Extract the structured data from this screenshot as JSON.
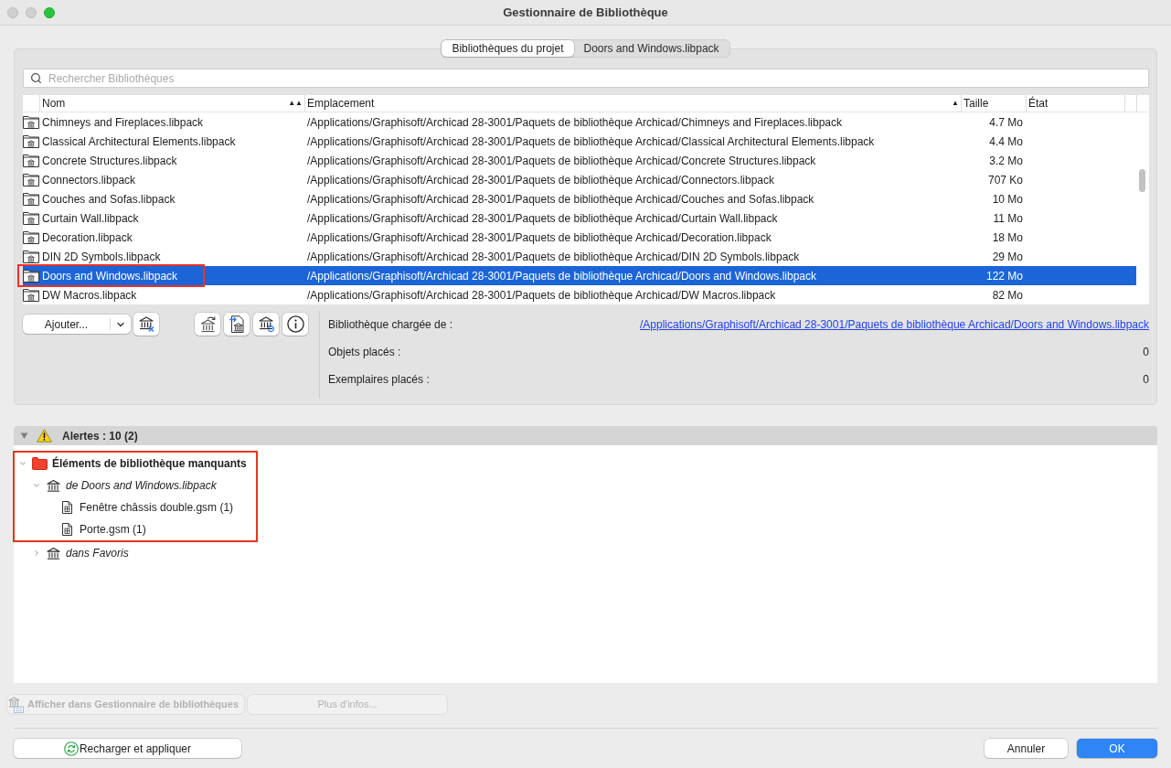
{
  "window": {
    "title": "Gestionnaire de Bibliothèque",
    "controls": [
      {
        "kind": "close",
        "disabled": true
      },
      {
        "kind": "minimize",
        "disabled": true
      },
      {
        "kind": "zoom",
        "disabled": false
      }
    ]
  },
  "tabs": [
    {
      "label": "Bibliothèques du projet",
      "selected": true
    },
    {
      "label": "Doors and Windows.libpack",
      "selected": false
    }
  ],
  "search": {
    "placeholder": "Rechercher Bibliothèques"
  },
  "table": {
    "columns": [
      {
        "label": "Nom",
        "sort_mark": "▲▲"
      },
      {
        "label": "Emplacement",
        "sort_mark": "▲"
      },
      {
        "label": "Taille"
      },
      {
        "label": "État"
      }
    ],
    "rows": [
      {
        "name": "Chimneys and Fireplaces.libpack",
        "location": "/Applications/Graphisoft/Archicad 28-3001/Paquets de bibliothèque Archicad/Chimneys and Fireplaces.libpack",
        "size": "4.7 Mo",
        "selected": false,
        "outlined": false
      },
      {
        "name": "Classical Architectural Elements.libpack",
        "location": "/Applications/Graphisoft/Archicad 28-3001/Paquets de bibliothèque Archicad/Classical Architectural Elements.libpack",
        "size": "4.4 Mo",
        "selected": false,
        "outlined": false
      },
      {
        "name": "Concrete Structures.libpack",
        "location": "/Applications/Graphisoft/Archicad 28-3001/Paquets de bibliothèque Archicad/Concrete Structures.libpack",
        "size": "3.2 Mo",
        "selected": false,
        "outlined": false
      },
      {
        "name": "Connectors.libpack",
        "location": "/Applications/Graphisoft/Archicad 28-3001/Paquets de bibliothèque Archicad/Connectors.libpack",
        "size": "707 Ko",
        "selected": false,
        "outlined": false
      },
      {
        "name": "Couches and Sofas.libpack",
        "location": "/Applications/Graphisoft/Archicad 28-3001/Paquets de bibliothèque Archicad/Couches and Sofas.libpack",
        "size": "10 Mo",
        "selected": false,
        "outlined": false
      },
      {
        "name": "Curtain Wall.libpack",
        "location": "/Applications/Graphisoft/Archicad 28-3001/Paquets de bibliothèque Archicad/Curtain Wall.libpack",
        "size": "11 Mo",
        "selected": false,
        "outlined": false
      },
      {
        "name": "Decoration.libpack",
        "location": "/Applications/Graphisoft/Archicad 28-3001/Paquets de bibliothèque Archicad/Decoration.libpack",
        "size": "18 Mo",
        "selected": false,
        "outlined": false
      },
      {
        "name": "DIN 2D Symbols.libpack",
        "location": "/Applications/Graphisoft/Archicad 28-3001/Paquets de bibliothèque Archicad/DIN 2D Symbols.libpack",
        "size": "29 Mo",
        "selected": false,
        "outlined": false
      },
      {
        "name": "Doors and Windows.libpack",
        "location": "/Applications/Graphisoft/Archicad 28-3001/Paquets de bibliothèque Archicad/Doors and Windows.libpack",
        "size": "122 Mo",
        "selected": true,
        "outlined": true
      },
      {
        "name": "DW Macros.libpack",
        "location": "/Applications/Graphisoft/Archicad 28-3001/Paquets de bibliothèque Archicad/DW Macros.libpack",
        "size": "82 Mo",
        "selected": false,
        "outlined": false
      }
    ]
  },
  "toolbar": {
    "add_button": {
      "label": "Ajouter..."
    }
  },
  "info": {
    "fields": [
      {
        "label": "Bibliothèque chargée de :",
        "value": "/Applications/Graphisoft/Archicad 28-3001/Paquets de bibliothèque Archicad/Doors and Windows.libpack",
        "kind": "link"
      },
      {
        "label": "Objets placés :",
        "value": "0",
        "kind": "text"
      },
      {
        "label": "Exemplaires placés :",
        "value": "0",
        "kind": "text"
      }
    ]
  },
  "alerts": {
    "title": "Alertes : 10 (2)",
    "expanded": true,
    "tree": [
      {
        "kind": "group",
        "label": "Éléments de bibliothèque manquants",
        "expanded": true,
        "outlined": true,
        "children": [
          {
            "kind": "library",
            "label": "de Doors and Windows.libpack",
            "expanded": true,
            "outlined": true,
            "children": [
              {
                "kind": "file",
                "label": "Fenêtre châssis double.gsm (1)",
                "outlined": true
              },
              {
                "kind": "file",
                "label": "Porte.gsm (1)",
                "outlined": true
              }
            ]
          },
          {
            "kind": "library",
            "label": "dans Favoris",
            "expanded": false,
            "outlined": false
          }
        ]
      }
    ]
  },
  "actions": [
    {
      "kind": "locate",
      "label": "Afficher dans Gestionnaire de bibliothèques",
      "disabled": true
    },
    {
      "kind": "details",
      "label": "Plus d'infos...",
      "disabled": true
    }
  ],
  "footer": {
    "buttons": [
      {
        "kind": "reload",
        "label": "Recharger et appliquer"
      },
      {
        "kind": "cancel",
        "label": "Annuler"
      },
      {
        "kind": "confirm",
        "label": "OK"
      }
    ]
  }
}
